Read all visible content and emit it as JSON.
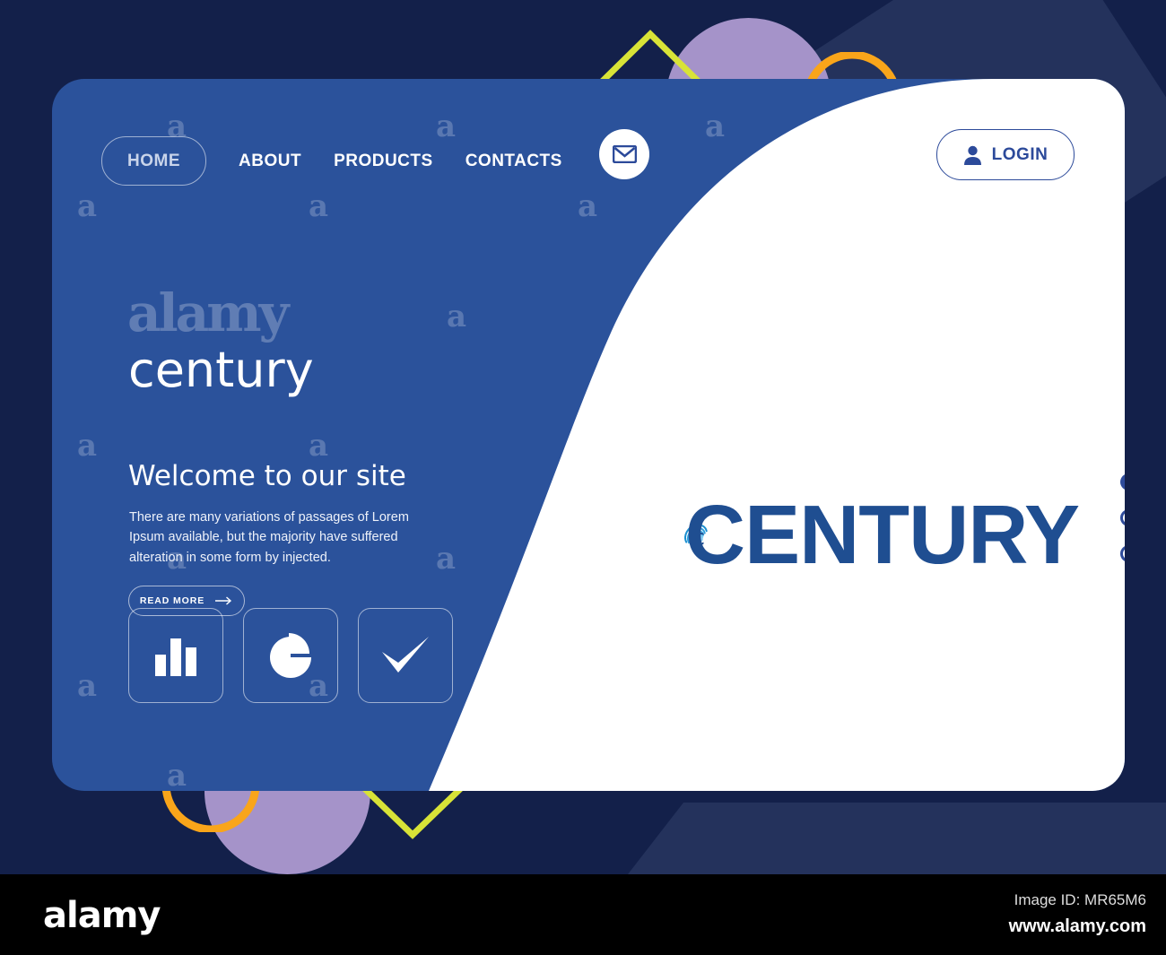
{
  "brand": {
    "wordmark": "century",
    "logo_text": "CENTURY",
    "logo_icon": "globe-swirl-icon"
  },
  "nav": {
    "active_item": "HOME",
    "items": [
      {
        "label": "HOME",
        "active": true
      },
      {
        "label": "ABOUT",
        "active": false
      },
      {
        "label": "PRODUCTS",
        "active": false
      },
      {
        "label": "CONTACTS",
        "active": false
      }
    ],
    "mail_icon": "envelope-icon",
    "login": {
      "label": "LOGIN",
      "icon": "user-icon"
    }
  },
  "hero": {
    "heading": "Welcome to our site",
    "paragraph": "There are many variations of passages of Lorem Ipsum available, but the majority have suffered alteration in some form by injected.",
    "cta": {
      "label": "READ MORE",
      "icon": "arrow-right-icon"
    }
  },
  "features": [
    {
      "icon": "bar-chart-icon"
    },
    {
      "icon": "pie-chart-icon"
    },
    {
      "icon": "check-mark-icon"
    }
  ],
  "carousel": {
    "total": 3,
    "active_index": 1
  },
  "footer": {
    "watermark": "alamy",
    "image_id_label": "Image ID: MR65M6",
    "url": "www.alamy.com"
  },
  "watermark_tile": {
    "letter": "a",
    "word": "alamy"
  },
  "colors": {
    "page_background": "#13204a",
    "card_blue": "#2b529b",
    "panel_white": "#ffffff",
    "accent_navy": "#2c4a9a",
    "logo_blue": "#1f4e91",
    "logo_swirl": "#2f9fdd",
    "deco_purple": "#a593c9",
    "deco_orange": "#f9a51a",
    "deco_lime": "#d8e337",
    "footer_black": "#000000"
  }
}
